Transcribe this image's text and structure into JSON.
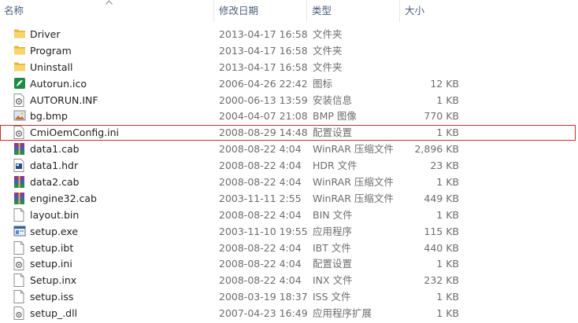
{
  "columns": {
    "name": "名称",
    "date": "修改日期",
    "type": "类型",
    "size": "大小"
  },
  "files": [
    {
      "name": "Driver",
      "date": "2013-04-17 16:58",
      "type": "文件夹",
      "size": "",
      "icon": "folder-icon"
    },
    {
      "name": "Program",
      "date": "2013-04-17 16:58",
      "type": "文件夹",
      "size": "",
      "icon": "folder-icon"
    },
    {
      "name": "Uninstall",
      "date": "2013-04-17 16:58",
      "type": "文件夹",
      "size": "",
      "icon": "folder-icon"
    },
    {
      "name": "Autorun.ico",
      "date": "2006-04-26 22:42",
      "type": "图标",
      "size": "12 KB",
      "icon": "ico-file-icon"
    },
    {
      "name": "AUTORUN.INF",
      "date": "2000-06-13 13:59",
      "type": "安装信息",
      "size": "1 KB",
      "icon": "settings-file-icon"
    },
    {
      "name": "bg.bmp",
      "date": "2004-04-07 21:08",
      "type": "BMP 图像",
      "size": "770 KB",
      "icon": "image-file-icon"
    },
    {
      "name": "CmiOemConfig.ini",
      "date": "2008-08-29 14:48",
      "type": "配置设置",
      "size": "1 KB",
      "icon": "settings-file-icon",
      "selected": true
    },
    {
      "name": "data1.cab",
      "date": "2008-08-22 4:04",
      "type": "WinRAR 压缩文件",
      "size": "2,896 KB",
      "icon": "winrar-archive-icon"
    },
    {
      "name": "data1.hdr",
      "date": "2008-08-22 4:04",
      "type": "HDR 文件",
      "size": "23 KB",
      "icon": "hdr-file-icon"
    },
    {
      "name": "data2.cab",
      "date": "2008-08-22 4:04",
      "type": "WinRAR 压缩文件",
      "size": "1 KB",
      "icon": "winrar-archive-icon"
    },
    {
      "name": "engine32.cab",
      "date": "2003-11-11 2:55",
      "type": "WinRAR 压缩文件",
      "size": "449 KB",
      "icon": "winrar-archive-icon"
    },
    {
      "name": "layout.bin",
      "date": "2008-08-22 4:04",
      "type": "BIN 文件",
      "size": "1 KB",
      "icon": "blank-file-icon"
    },
    {
      "name": "setup.exe",
      "date": "2003-11-10 19:55",
      "type": "应用程序",
      "size": "115 KB",
      "icon": "exe-file-icon"
    },
    {
      "name": "setup.ibt",
      "date": "2008-08-22 4:04",
      "type": "IBT 文件",
      "size": "440 KB",
      "icon": "blank-file-icon"
    },
    {
      "name": "setup.ini",
      "date": "2008-08-22 4:04",
      "type": "配置设置",
      "size": "1 KB",
      "icon": "settings-file-icon"
    },
    {
      "name": "Setup.inx",
      "date": "2008-08-22 4:04",
      "type": "INX 文件",
      "size": "232 KB",
      "icon": "blank-file-icon"
    },
    {
      "name": "setup.iss",
      "date": "2008-03-19 18:37",
      "type": "ISS 文件",
      "size": "1 KB",
      "icon": "blank-file-icon"
    },
    {
      "name": "setup_.dll",
      "date": "2007-04-23 16:49",
      "type": "应用程序扩展",
      "size": "1 KB",
      "icon": "dll-file-icon"
    }
  ],
  "colors": {
    "header_text": "#4c607a",
    "selection_border": "#d42a2a",
    "folder": "#f2c94c"
  }
}
